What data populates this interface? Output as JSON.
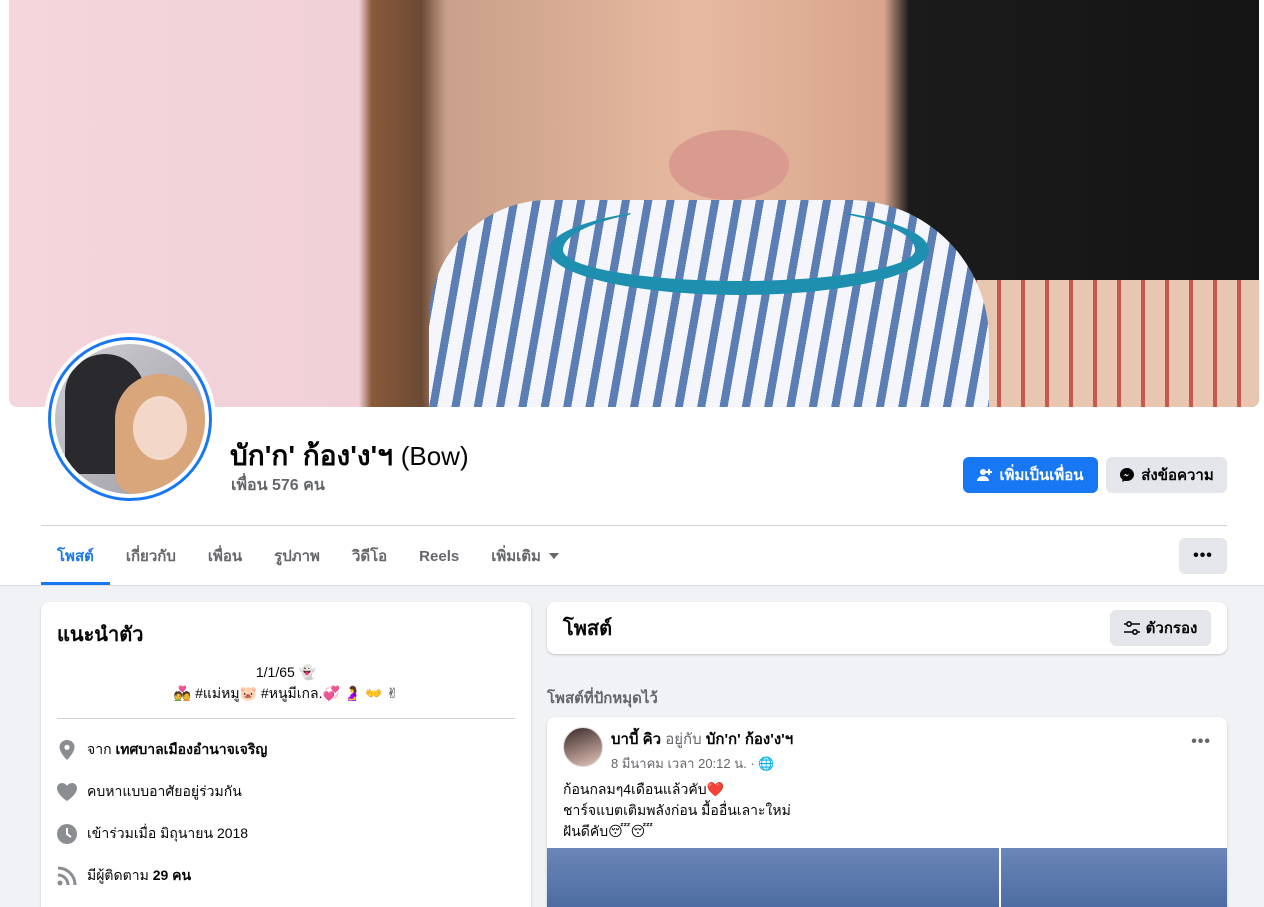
{
  "profile": {
    "name": "บัก'ก' ก้อง'ง'ฯ",
    "alt_name": "(Bow)",
    "friends": "เพื่อน 576 คน"
  },
  "actions": {
    "add_friend": "เพิ่มเป็นเพื่อน",
    "message": "ส่งข้อความ"
  },
  "tabs": [
    "โพสต์",
    "เกี่ยวกับ",
    "เพื่อน",
    "รูปภาพ",
    "วิดีโอ",
    "Reels",
    "เพิ่มเติม"
  ],
  "more_label": "•••",
  "intro": {
    "title": "แนะนำตัว",
    "bio_line1": "1/1/65 👻",
    "bio_line2": "💑 #แม่หมู🐷 #หนูมีเกล.💞 🤰 👐 ✌",
    "from_label": "จาก ",
    "from_value": "เทศบาลเมืองอำนาจเจริญ",
    "relationship": "คบหาแบบอาศัยอยู่ร่วมกัน",
    "joined": "เข้าร่วมเมื่อ มิถุนายน 2018",
    "followers_label": "มีผู้ติดตาม ",
    "followers_value": "29 คน"
  },
  "posts": {
    "title": "โพสต์",
    "filter": "ตัวกรอง",
    "pinned": "โพสต์ที่ปักหมุดไว้"
  },
  "post": {
    "author": "บาบี้ คิว",
    "relation": " อยู่กับ ",
    "with": "บัก'ก' ก้อง'ง'ฯ",
    "time": "8 มีนาคม เวลา 20:12 น. · 🌐",
    "line1": "ก้อนกลมๆ4เดือนแล้วคับ❤️",
    "line2": "ชาร์จแบตเติมพลังก่อน มื้ออื่นเลาะใหม่",
    "line3": "ฝันดีคับ😴😴",
    "more": "•••"
  },
  "colors": {
    "accent": "#1877f2",
    "text_secondary": "#65676b"
  }
}
